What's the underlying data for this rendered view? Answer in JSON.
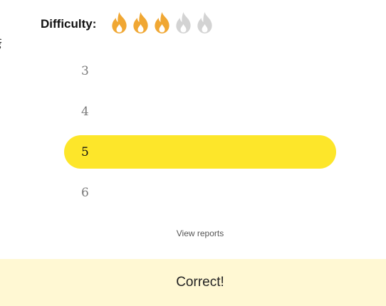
{
  "difficulty": {
    "label": "Difficulty:",
    "rating": 3,
    "max_rating": 5,
    "active_color": "#f0a733",
    "inactive_color": "#d3d3d3",
    "icon": "flame-icon"
  },
  "stray_text": "ई",
  "options": [
    {
      "label": "3",
      "selected": false
    },
    {
      "label": "4",
      "selected": false
    },
    {
      "label": "5",
      "selected": true
    },
    {
      "label": "6",
      "selected": false
    }
  ],
  "selected_color": "#fde62a",
  "view_reports_label": "View reports",
  "result": {
    "text": "Correct!",
    "background": "#fff8d3"
  }
}
